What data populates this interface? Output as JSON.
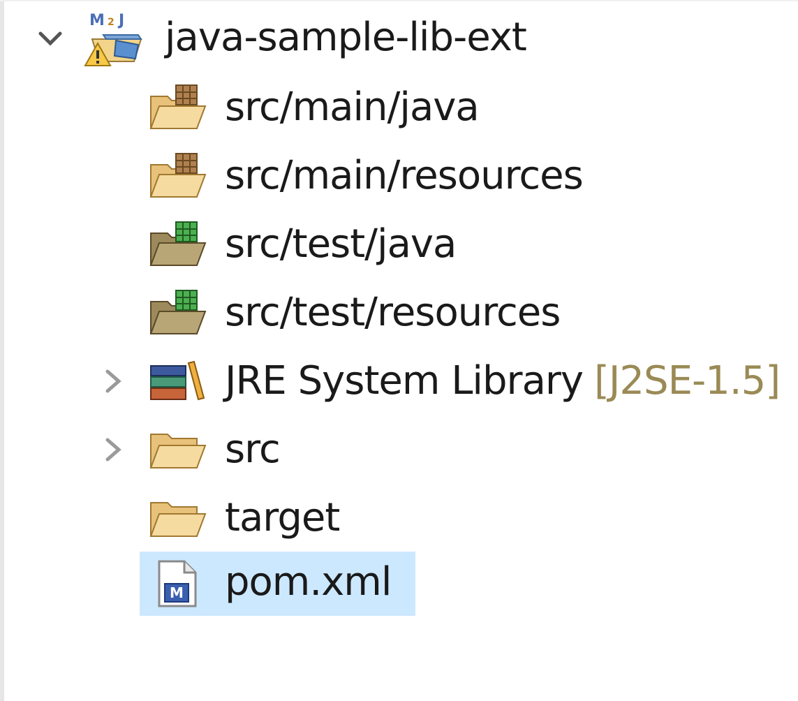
{
  "tree": {
    "project": {
      "label": "java-sample-lib-ext",
      "icon": "maven-project-warning-icon",
      "expanded": true
    },
    "items": [
      {
        "label": "src/main/java",
        "icon": "package-folder-icon"
      },
      {
        "label": "src/main/resources",
        "icon": "package-folder-icon"
      },
      {
        "label": "src/test/java",
        "icon": "test-package-folder-icon"
      },
      {
        "label": "src/test/resources",
        "icon": "test-package-folder-icon"
      },
      {
        "label": "JRE System Library",
        "decoration": "[J2SE-1.5]",
        "icon": "library-icon",
        "expandable": true
      },
      {
        "label": "src",
        "icon": "folder-icon",
        "expandable": true
      },
      {
        "label": "target",
        "icon": "folder-icon"
      },
      {
        "label": "pom.xml",
        "icon": "maven-pom-file-icon",
        "selected": true
      }
    ]
  },
  "colors": {
    "selection": "#cce8ff",
    "decoration": "#9a8a55",
    "text": "#1a1a1a"
  }
}
